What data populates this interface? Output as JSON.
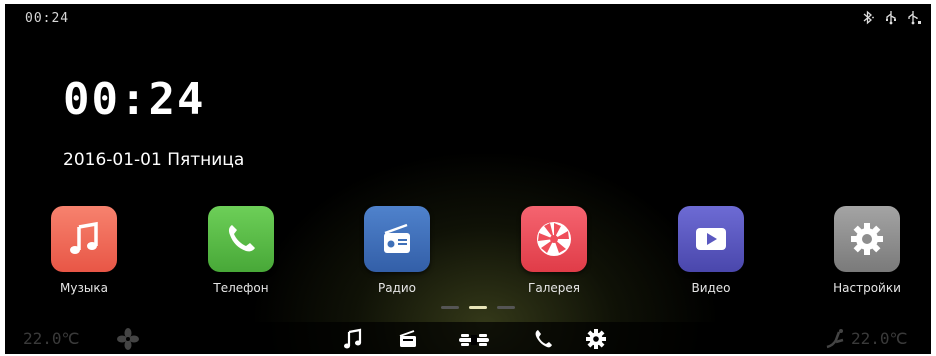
{
  "status": {
    "time": "00:24",
    "icons": [
      "bluetooth-icon",
      "usb-icon",
      "usb-2-icon"
    ]
  },
  "clock": "00:24",
  "date": "2016-01-01 Пятница",
  "apps": [
    {
      "label": "Музыка",
      "icon": "music-note-icon",
      "color": "#f06a58"
    },
    {
      "label": "Телефон",
      "icon": "phone-icon",
      "color": "#5cbf48"
    },
    {
      "label": "Радио",
      "icon": "radio-icon",
      "color": "#3f70b8"
    },
    {
      "label": "Галерея",
      "icon": "aperture-icon",
      "color": "#ef4e5a"
    },
    {
      "label": "Видео",
      "icon": "play-icon",
      "color": "#5a58c0"
    },
    {
      "label": "Настройки",
      "icon": "gear-icon",
      "color": "#8e8e8e"
    }
  ],
  "pager": {
    "pages": 3,
    "active": 1
  },
  "dock": {
    "left_temp": "22.0℃",
    "right_temp": "22.0℃",
    "icons": [
      "fan-icon",
      "music-icon",
      "radio-icon",
      "car-icon",
      "phone-icon",
      "gear-icon",
      "seat-icon"
    ]
  }
}
